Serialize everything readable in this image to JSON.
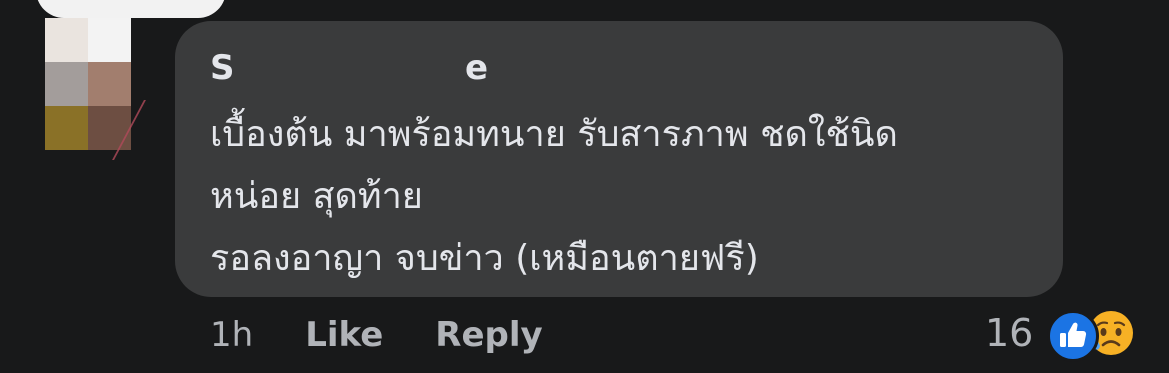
{
  "comment": {
    "author_visible_start": "S",
    "author_visible_end": "e",
    "lines": [
      "เบื้องต้น มาพร้อมทนาย รับสารภาพ ชดใช้นิด",
      "หน่อย สุดท้าย",
      "รอลงอาญา จบข่าว (เหมือนตายฟรี)"
    ]
  },
  "actions": {
    "time": "1h",
    "like_label": "Like",
    "reply_label": "Reply"
  },
  "reactions": {
    "count": "16",
    "icons": [
      "like-icon",
      "sad-icon"
    ],
    "like_color": "#1b74e4",
    "sad_color": "#f7b125"
  },
  "avatar": {
    "style": "pixelated",
    "colors": [
      "#eae4df",
      "#f3f3f3",
      "#a39d9b",
      "#a27e6e",
      "#8a7127",
      "#6d4e42"
    ]
  },
  "theme": {
    "background": "#18191a",
    "bubble": "#3a3b3c",
    "text": "#e4e6eb",
    "muted": "#b0b3b8"
  }
}
